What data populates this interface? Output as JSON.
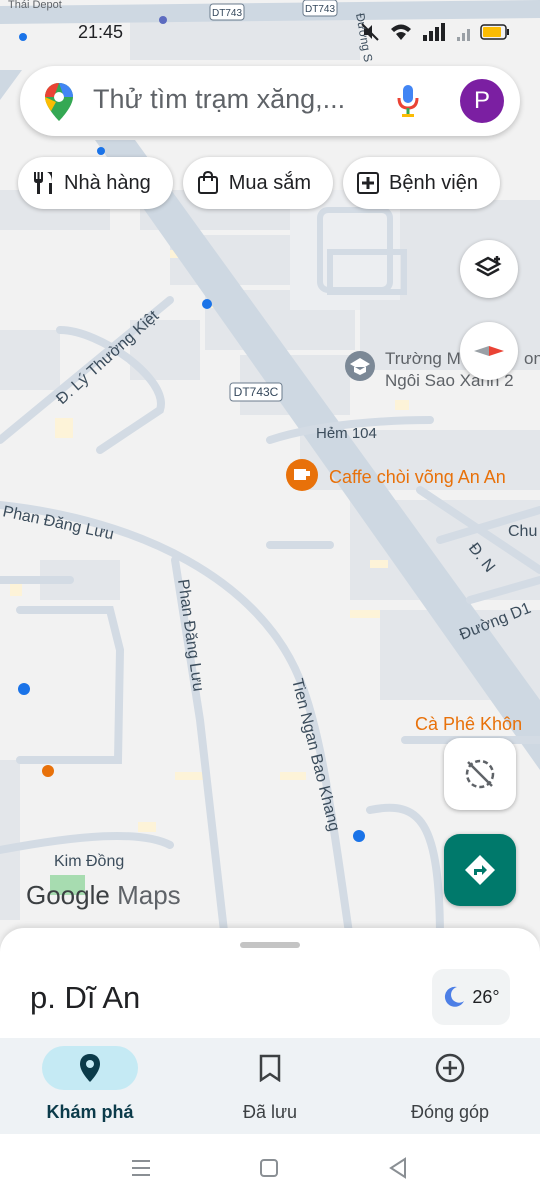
{
  "status": {
    "time": "21:45"
  },
  "search": {
    "placeholder": "Thử tìm trạm xăng,..."
  },
  "account": {
    "initial": "P",
    "color": "#7b1fa2"
  },
  "chips": [
    {
      "label": "Nhà hàng",
      "icon": "restaurant-icon"
    },
    {
      "label": "Mua sắm",
      "icon": "shopping-bag-icon"
    },
    {
      "label": "Bệnh viện",
      "icon": "hospital-icon"
    }
  ],
  "map": {
    "top_labels": {
      "left": "Thái Depot",
      "route1": "DT743",
      "route2": "DT743",
      "street_top": "Đường S"
    },
    "road_shield": "DT743C",
    "streets": {
      "ly_thuong_kiet": "Đ. Lý Thường Kiệt",
      "hem104": "Hẻm 104",
      "phan_dang_luu1": "Phan Đăng Lưu",
      "phan_dang_luu2": "Phan Đăng Lưu",
      "tien_ngan": "Tien Ngan Bao Khang",
      "kim_dong": "Kim Đồng",
      "dn": "Đ. N",
      "duong_d1": "Đường D1",
      "chu": "Chu"
    },
    "pois": {
      "school_line1": "Trường M",
      "school_line1_suffix": "on",
      "school_line2": "Ngôi Sao Xanh 2",
      "cafe": "Caffe chòi võng An An",
      "cafe2": "Cà Phê Khôn"
    },
    "attribution": {
      "google": "Google",
      "maps": "Maps"
    }
  },
  "sheet": {
    "place": "p. Dĩ An",
    "weather_temp": "26°",
    "weather_icon": "moon-icon"
  },
  "bottom_nav": [
    {
      "label": "Khám phá",
      "icon": "location-pin-icon",
      "active": true
    },
    {
      "label": "Đã lưu",
      "icon": "bookmark-icon",
      "active": false
    },
    {
      "label": "Đóng góp",
      "icon": "add-circle-icon",
      "active": false
    }
  ],
  "colors": {
    "accent": "#00796b",
    "poi_orange": "#e8710a",
    "active_nav": "#c5eaf4"
  }
}
